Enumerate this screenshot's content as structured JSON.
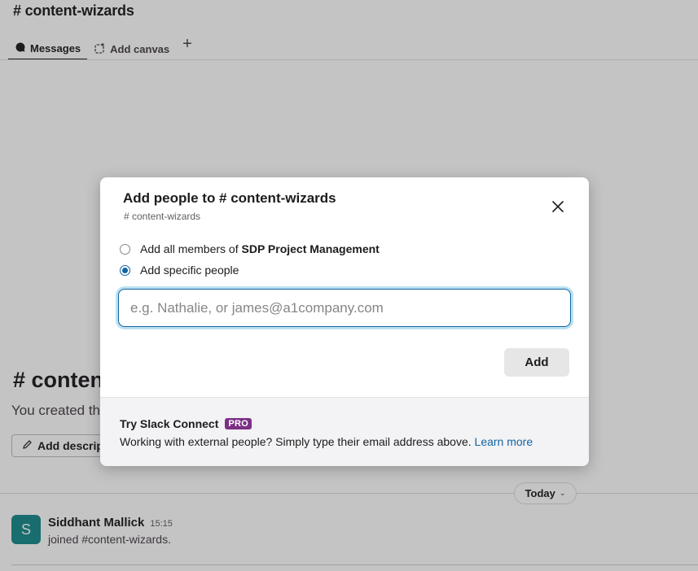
{
  "channel": {
    "title": "# content-wizards",
    "tabs": [
      {
        "label": "Messages",
        "icon": "message-bubble-icon",
        "active": true
      },
      {
        "label": "Add canvas",
        "icon": "canvas-icon",
        "active": false
      }
    ],
    "add_tab_icon": "+",
    "intro_title": "# conten",
    "intro_text": "You created th",
    "add_description_label": "Add descript"
  },
  "day_divider": {
    "label": "Today"
  },
  "message": {
    "avatar_initial": "S",
    "author": "Siddhant Mallick",
    "time": "15:15",
    "text": "joined #content-wizards."
  },
  "modal": {
    "title": "Add people to # content-wizards",
    "subtitle": "# content-wizards",
    "close_icon": "close-icon",
    "options": [
      {
        "prefix": "Add all members of ",
        "bold": "SDP Project Management",
        "selected": false
      },
      {
        "prefix": "Add specific people",
        "bold": "",
        "selected": true
      }
    ],
    "input": {
      "placeholder": "e.g. Nathalie, or james@a1company.com",
      "value": ""
    },
    "add_button": "Add",
    "footer": {
      "heading": "Try Slack Connect",
      "badge": "PRO",
      "text": "Working with external people? Simply type their email address above.",
      "link": "Learn more"
    }
  },
  "colors": {
    "accent": "#1264a3",
    "pro_badge": "#7c3085",
    "avatar": "#178a8a",
    "overlay": "rgba(29,28,29,0.26)"
  }
}
